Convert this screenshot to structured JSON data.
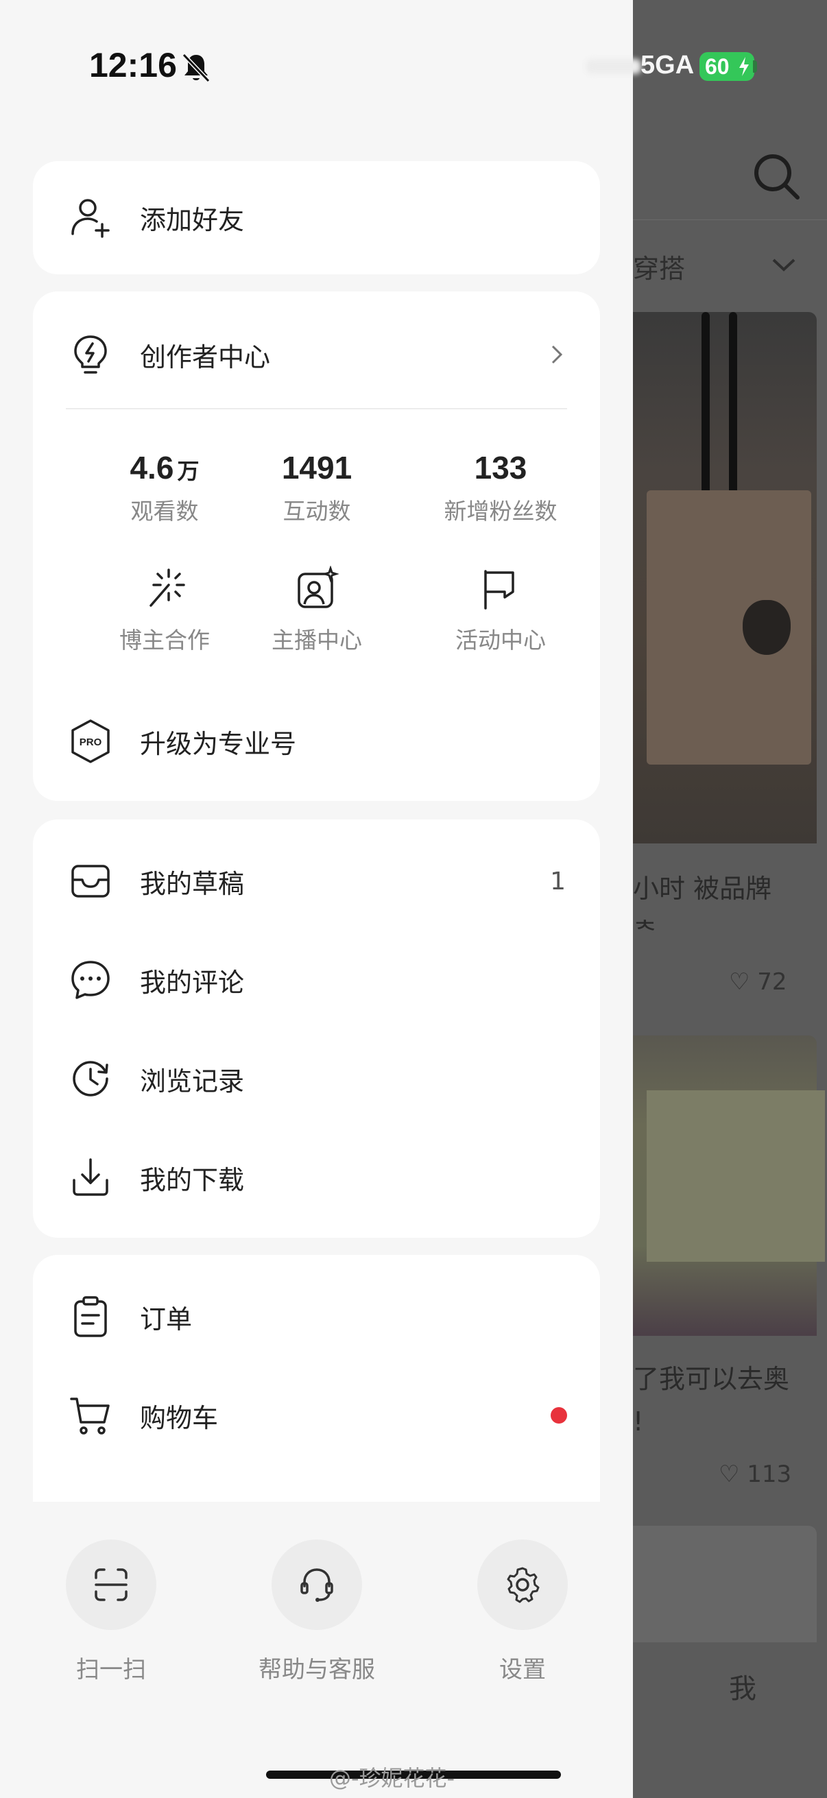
{
  "status_bar": {
    "time": "12:16",
    "network": "5GA",
    "battery": "60"
  },
  "drawer": {
    "add_friend": {
      "label": "添加好友",
      "icon": "add-user-icon"
    },
    "creator_center": {
      "label": "创作者中心",
      "icon": "lightbulb-bolt-icon",
      "stats": [
        {
          "value": "4.6",
          "unit": "万",
          "caption": "观看数"
        },
        {
          "value": "1491",
          "unit": "",
          "caption": "互动数"
        },
        {
          "value": "133",
          "unit": "",
          "caption": "新增粉丝数"
        }
      ],
      "tools": [
        {
          "label": "博主合作",
          "icon": "magic-wand-icon"
        },
        {
          "label": "主播中心",
          "icon": "live-portrait-icon"
        },
        {
          "label": "活动中心",
          "icon": "flag-icon"
        }
      ],
      "upgrade": {
        "label": "升级为专业号",
        "icon": "pro-badge-icon",
        "badge_text": "PRO"
      }
    },
    "content_menu": [
      {
        "label": "我的草稿",
        "icon": "inbox-tray-icon",
        "count": "1"
      },
      {
        "label": "我的评论",
        "icon": "chat-bubble-icon"
      },
      {
        "label": "浏览记录",
        "icon": "history-clock-icon"
      },
      {
        "label": "我的下载",
        "icon": "download-icon"
      }
    ],
    "shop_menu": [
      {
        "label": "订单",
        "icon": "clipboard-icon"
      },
      {
        "label": "购物车",
        "icon": "shopping-cart-icon",
        "has_dot": true
      }
    ],
    "bottom_actions": [
      {
        "label": "扫一扫",
        "icon": "scan-icon"
      },
      {
        "label": "帮助与客服",
        "icon": "headset-icon"
      },
      {
        "label": "设置",
        "icon": "gear-icon"
      }
    ]
  },
  "background_app": {
    "filter_text": "穿搭",
    "card1_title_line1": "小时 被品牌",
    "card1_title_line2": "ᅕ",
    "card1_likes": "72",
    "card2_title_line1": "了我可以去奥",
    "card2_title_line2": "!",
    "card2_likes": "113",
    "tab_me": "我"
  },
  "watermark": "@-珍妮花花-",
  "colors": {
    "accent_red": "#e8323c",
    "battery_green": "#34c759",
    "card_bg": "#ffffff",
    "page_bg": "#f6f6f6",
    "overlay_dim": "#5b5b5b"
  }
}
